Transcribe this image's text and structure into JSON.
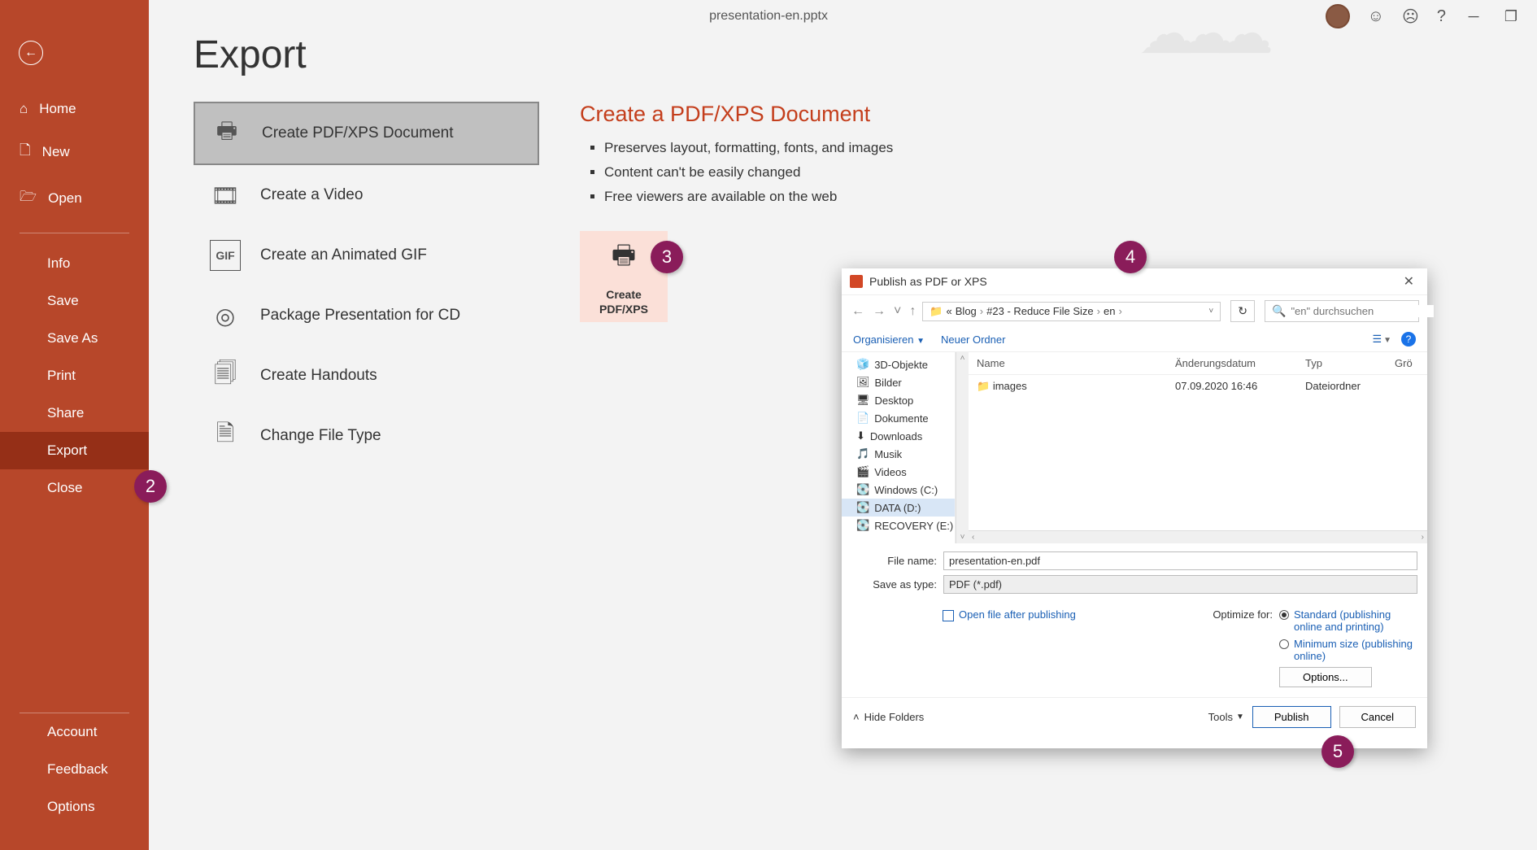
{
  "title": "presentation-en.pptx",
  "sidebar": {
    "top": [
      {
        "label": "Home",
        "icon": "home"
      },
      {
        "label": "New",
        "icon": "new"
      },
      {
        "label": "Open",
        "icon": "open"
      }
    ],
    "mid": [
      {
        "label": "Info"
      },
      {
        "label": "Save"
      },
      {
        "label": "Save As"
      },
      {
        "label": "Print"
      },
      {
        "label": "Share"
      },
      {
        "label": "Export",
        "active": true
      },
      {
        "label": "Close"
      }
    ],
    "bottom": [
      {
        "label": "Account"
      },
      {
        "label": "Feedback"
      },
      {
        "label": "Options"
      }
    ]
  },
  "page": {
    "heading": "Export",
    "options": [
      {
        "label": "Create PDF/XPS Document",
        "selected": true
      },
      {
        "label": "Create a Video"
      },
      {
        "label": "Create an Animated GIF"
      },
      {
        "label": "Package Presentation for CD"
      },
      {
        "label": "Create Handouts"
      },
      {
        "label": "Change File Type"
      }
    ],
    "detail": {
      "heading": "Create a PDF/XPS Document",
      "bullets": [
        "Preserves layout, formatting, fonts, and images",
        "Content can't be easily changed",
        "Free viewers are available on the web"
      ],
      "button_line1": "Create",
      "button_line2": "PDF/XPS"
    }
  },
  "callouts": {
    "two": "2",
    "three": "3",
    "four": "4",
    "five": "5"
  },
  "dialog": {
    "title": "Publish as PDF or XPS",
    "breadcrumb": [
      "«",
      "Blog",
      "#23 - Reduce File Size",
      "en"
    ],
    "search_placeholder": "\"en\" durchsuchen",
    "organize": "Organisieren",
    "new_folder": "Neuer Ordner",
    "tree": [
      "3D-Objekte",
      "Bilder",
      "Desktop",
      "Dokumente",
      "Downloads",
      "Musik",
      "Videos",
      "Windows (C:)",
      "DATA (D:)",
      "RECOVERY (E:)"
    ],
    "tree_selected": "DATA (D:)",
    "columns": {
      "name": "Name",
      "date": "Änderungsdatum",
      "type": "Typ",
      "size": "Grö"
    },
    "rows": [
      {
        "name": "images",
        "date": "07.09.2020 16:46",
        "type": "Dateiordner"
      }
    ],
    "filename_label": "File name:",
    "filename": "presentation-en.pdf",
    "savetype_label": "Save as type:",
    "savetype": "PDF (*.pdf)",
    "open_after": "Open file after publishing",
    "optimize_label": "Optimize for:",
    "opt1": "Standard (publishing online and printing)",
    "opt2": "Minimum size (publishing online)",
    "options_btn": "Options...",
    "hide_folders": "Hide Folders",
    "tools": "Tools",
    "publish": "Publish",
    "cancel": "Cancel"
  }
}
